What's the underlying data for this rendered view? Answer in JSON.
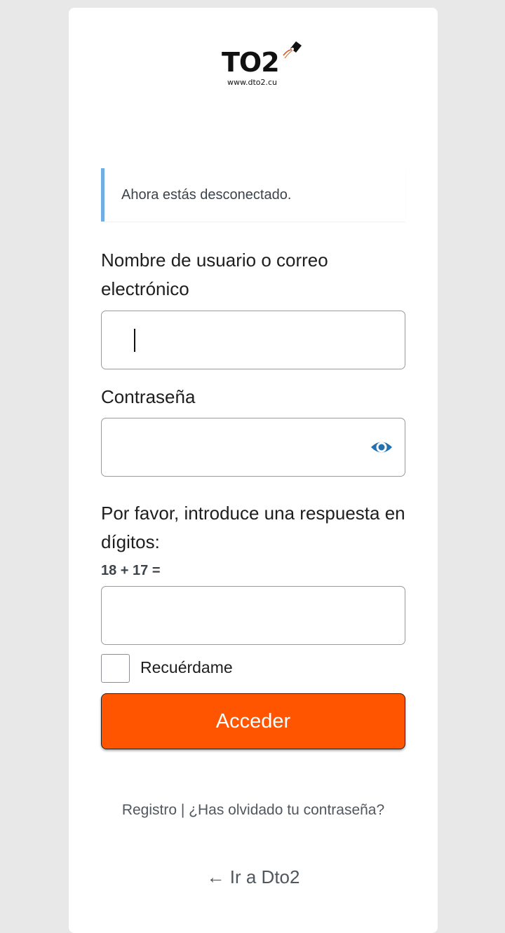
{
  "logo": {
    "text": "TO2",
    "url": "www.dto2.cu"
  },
  "notice": {
    "message": "Ahora estás desconectado."
  },
  "form": {
    "username_label": "Nombre de usuario o correo electrónico",
    "username_value": "",
    "password_label": "Contraseña",
    "password_value": "",
    "password_toggle_icon": "eye-icon",
    "captcha_label": "Por favor, introduce una respuesta en dígitos:",
    "captcha_question": "18 + 17 =",
    "captcha_value": "",
    "remember_label": "Recuérdame",
    "remember_checked": false,
    "submit_label": "Acceder"
  },
  "links": {
    "register": "Registro",
    "separator": "|",
    "lost_password": "¿Has olvidado tu contraseña?",
    "back_arrow": "←",
    "back_label": "Ir a Dto2"
  },
  "colors": {
    "background": "#e8e8e8",
    "card": "#ffffff",
    "notice_accent": "#72aee6",
    "button": "#ff5500",
    "eye_icon": "#2271b1"
  }
}
